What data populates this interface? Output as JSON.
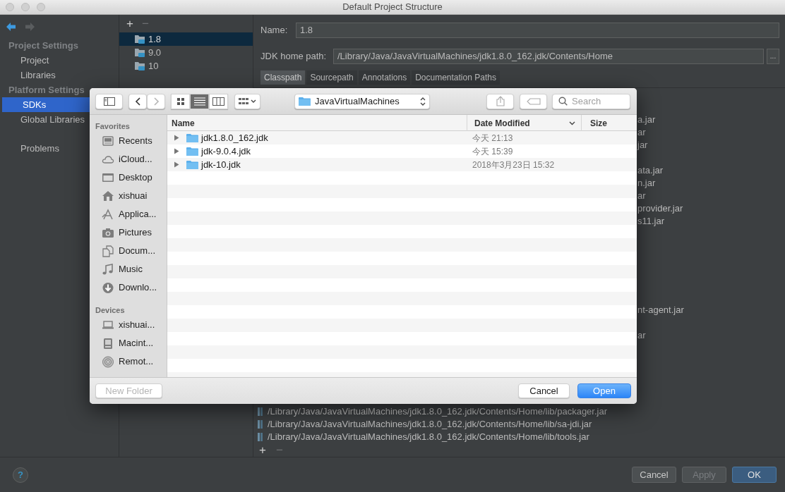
{
  "window": {
    "title": "Default Project Structure"
  },
  "nav": [
    {
      "kind": "back",
      "disabled": false
    },
    {
      "kind": "forward",
      "disabled": true
    }
  ],
  "sidebar": {
    "items": [
      {
        "kind": "heading",
        "label": "Project Settings",
        "selected": false
      },
      {
        "kind": "item",
        "label": "Project",
        "selected": false
      },
      {
        "kind": "item",
        "label": "Libraries",
        "selected": false
      },
      {
        "kind": "heading",
        "label": "Platform Settings",
        "selected": false
      },
      {
        "kind": "item",
        "label": "SDKs",
        "selected": true
      },
      {
        "kind": "item",
        "label": "Global Libraries",
        "selected": false
      },
      {
        "kind": "separated",
        "label": "Problems",
        "selected": false
      }
    ]
  },
  "sdk_list": {
    "toolbar": [
      "+",
      "−"
    ],
    "items": [
      {
        "label": "1.8",
        "selected": true
      },
      {
        "label": "9.0",
        "selected": false
      },
      {
        "label": "10",
        "selected": false
      }
    ]
  },
  "detail": {
    "name_label": "Name:",
    "name_value": "1.8",
    "home_label": "JDK home path:",
    "home_value": "/Library/Java/JavaVirtualMachines/jdk1.8.0_162.jdk/Contents/Home",
    "browse": "...",
    "tabs": [
      {
        "label": "Classpath",
        "selected": true
      },
      {
        "label": "Sourcepath",
        "selected": false
      },
      {
        "label": "Annotations",
        "selected": false
      },
      {
        "label": "Documentation Paths",
        "selected": false
      }
    ],
    "classpath": [
      {
        "kind": "hidden"
      },
      {
        "kind": "hidden"
      },
      {
        "kind": "partial",
        "text": "a.jar"
      },
      {
        "kind": "partial",
        "text": "ar"
      },
      {
        "kind": "partial",
        "text": "jar"
      },
      {
        "kind": "hidden"
      },
      {
        "kind": "partial",
        "text": "ata.jar"
      },
      {
        "kind": "partial",
        "text": "n.jar"
      },
      {
        "kind": "partial",
        "text": "ar"
      },
      {
        "kind": "partial",
        "text": "provider.jar"
      },
      {
        "kind": "partial",
        "text": "s11.jar"
      },
      {
        "kind": "hidden"
      },
      {
        "kind": "hidden"
      },
      {
        "kind": "hidden"
      },
      {
        "kind": "hidden"
      },
      {
        "kind": "hidden"
      },
      {
        "kind": "hidden"
      },
      {
        "kind": "partial",
        "text": "nt-agent.jar"
      },
      {
        "kind": "hidden"
      },
      {
        "kind": "partial",
        "text": "ar"
      },
      {
        "kind": "hidden"
      },
      {
        "kind": "hidden"
      },
      {
        "kind": "hidden"
      },
      {
        "kind": "hidden"
      },
      {
        "kind": "hidden"
      },
      {
        "kind": "full",
        "text": "/Library/Java/JavaVirtualMachines/jdk1.8.0_162.jdk/Contents/Home/lib/packager.jar"
      },
      {
        "kind": "full",
        "text": "/Library/Java/JavaVirtualMachines/jdk1.8.0_162.jdk/Contents/Home/lib/sa-jdi.jar"
      },
      {
        "kind": "full",
        "text": "/Library/Java/JavaVirtualMachines/jdk1.8.0_162.jdk/Contents/Home/lib/tools.jar"
      }
    ],
    "toolbar": [
      "+",
      "−"
    ]
  },
  "footer": {
    "help": "?",
    "buttons": [
      {
        "label": "Cancel",
        "disabled": false,
        "default": false
      },
      {
        "label": "Apply",
        "disabled": true,
        "default": false
      },
      {
        "label": "OK",
        "disabled": false,
        "default": true
      }
    ]
  },
  "dialog": {
    "toolbar": {
      "nav": [
        {
          "kind": "back",
          "disabled": false
        },
        {
          "kind": "forward",
          "disabled": true
        }
      ],
      "view_modes": [
        {
          "kind": "icons",
          "selected": false
        },
        {
          "kind": "list",
          "selected": true
        },
        {
          "kind": "columns",
          "selected": false
        }
      ],
      "location": "JavaVirtualMachines",
      "search": {
        "placeholder": "Search"
      }
    },
    "sidebar": [
      {
        "heading": "Favorites",
        "items": [
          {
            "kind": "recents",
            "label": "Recents"
          },
          {
            "kind": "icloud",
            "label": "iCloud..."
          },
          {
            "kind": "desktop",
            "label": "Desktop"
          },
          {
            "kind": "home",
            "label": "xishuai"
          },
          {
            "kind": "apps",
            "label": "Applica..."
          },
          {
            "kind": "pictures",
            "label": "Pictures"
          },
          {
            "kind": "documents",
            "label": "Docum..."
          },
          {
            "kind": "music",
            "label": "Music"
          },
          {
            "kind": "downloads",
            "label": "Downlo..."
          }
        ]
      },
      {
        "heading": "Devices",
        "items": [
          {
            "kind": "laptop",
            "label": "xishuai..."
          },
          {
            "kind": "disk",
            "label": "Macint..."
          },
          {
            "kind": "disc",
            "label": "Remot..."
          }
        ]
      }
    ],
    "columns": [
      {
        "label": "Name",
        "sorted": false
      },
      {
        "label": "Date Modified",
        "sorted": true
      },
      {
        "label": "Size",
        "sorted": false
      }
    ],
    "files": [
      {
        "name": "jdk1.8.0_162.jdk",
        "modified": "今天 21:13",
        "expanded": false
      },
      {
        "name": "jdk-9.0.4.jdk",
        "modified": "今天 15:39",
        "expanded": false
      },
      {
        "name": "jdk-10.jdk",
        "modified": "2018年3月23日 15:32",
        "expanded": false
      }
    ],
    "buttons": [
      {
        "label": "New Folder",
        "disabled": true,
        "default": false
      },
      {
        "label": "Cancel",
        "disabled": false,
        "default": false
      },
      {
        "label": "Open",
        "disabled": false,
        "default": true
      }
    ]
  }
}
